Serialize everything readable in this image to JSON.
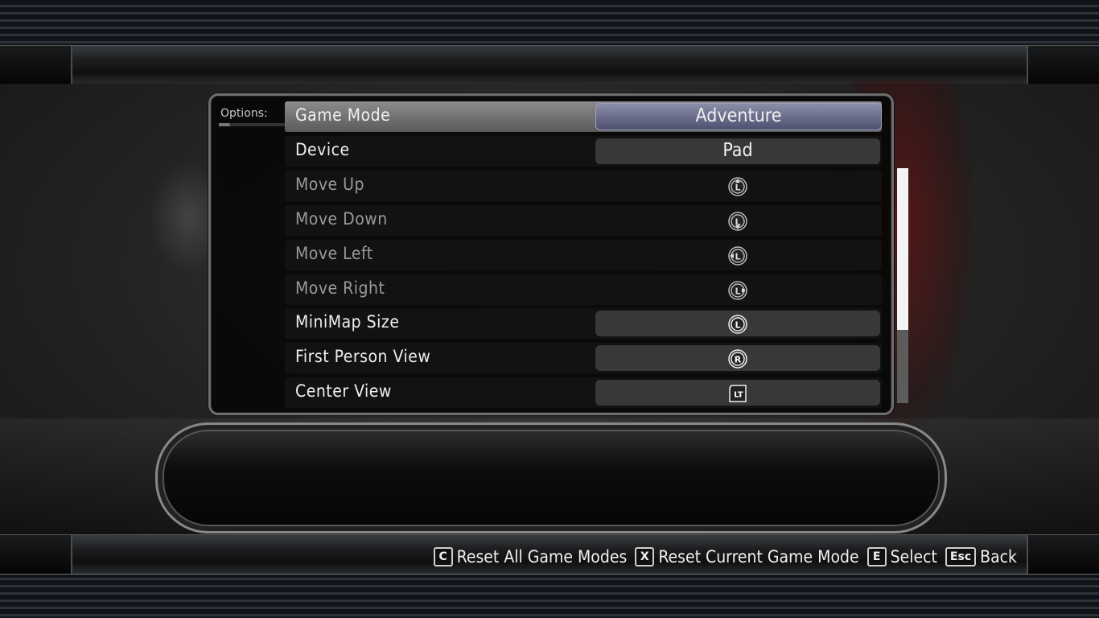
{
  "options_label": "Options:",
  "rows": [
    {
      "label": "Game Mode",
      "value": "Adventure",
      "icon": null,
      "state": "active"
    },
    {
      "label": "Device",
      "value": "Pad",
      "icon": null,
      "state": "normal"
    },
    {
      "label": "Move Up",
      "value": null,
      "icon": "left-stick-up-icon",
      "state": "dim"
    },
    {
      "label": "Move Down",
      "value": null,
      "icon": "left-stick-down-icon",
      "state": "dim"
    },
    {
      "label": "Move Left",
      "value": null,
      "icon": "left-stick-left-icon",
      "state": "dim"
    },
    {
      "label": "Move Right",
      "value": null,
      "icon": "left-stick-right-icon",
      "state": "dim"
    },
    {
      "label": "MiniMap Size",
      "value": null,
      "icon": "left-stick-click-icon",
      "state": "normal"
    },
    {
      "label": "First Person View",
      "value": null,
      "icon": "right-stick-click-icon",
      "state": "normal"
    },
    {
      "label": "Center View",
      "value": null,
      "icon": "left-trigger-icon",
      "state": "normal"
    }
  ],
  "icon_glyphs": {
    "left-stick": "L",
    "right-stick": "R",
    "left-trigger": "LT"
  },
  "scrollbar": {
    "thumb_fraction": 0.69,
    "position": 0.0
  },
  "hints": [
    {
      "key": "C",
      "label": "Reset All Game Modes"
    },
    {
      "key": "X",
      "label": "Reset Current Game Mode"
    },
    {
      "key": "E",
      "label": "Select"
    },
    {
      "key": "Esc",
      "label": "Back"
    }
  ],
  "colors": {
    "accent": "#6e7296",
    "highlight": "#8c8c8c",
    "emblem": "#7a0c0c"
  }
}
